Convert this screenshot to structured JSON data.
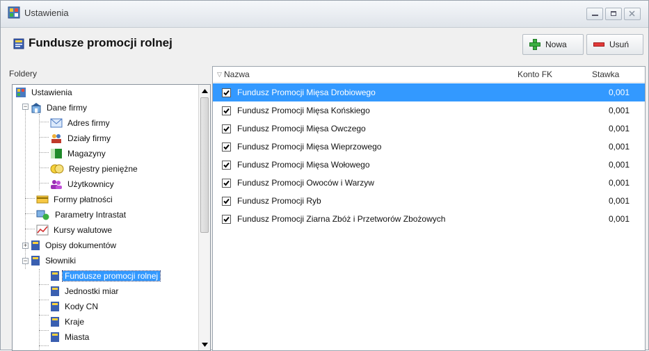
{
  "window": {
    "title": "Ustawienia",
    "header_title": "Fundusze promocji rolnej"
  },
  "toolbar": {
    "new_label": "Nowa",
    "delete_label": "Usuń"
  },
  "left": {
    "header": "Foldery",
    "tree": [
      {
        "label": "Ustawienia"
      },
      {
        "label": "Dane firmy"
      },
      {
        "label": "Adres firmy"
      },
      {
        "label": "Działy firmy"
      },
      {
        "label": "Magazyny"
      },
      {
        "label": "Rejestry pieniężne"
      },
      {
        "label": "Użytkownicy"
      },
      {
        "label": "Formy płatności"
      },
      {
        "label": "Parametry Intrastat"
      },
      {
        "label": "Kursy walutowe"
      },
      {
        "label": "Opisy dokumentów"
      },
      {
        "label": "Słowniki"
      },
      {
        "label": "Fundusze promocji rolnej"
      },
      {
        "label": "Jednostki miar"
      },
      {
        "label": "Kody CN"
      },
      {
        "label": "Kraje"
      },
      {
        "label": "Miasta"
      }
    ]
  },
  "table": {
    "columns": {
      "name": "Nazwa",
      "konto": "Konto FK",
      "stawka": "Stawka"
    },
    "rows": [
      {
        "name": "Fundusz Promocji Mięsa Drobiowego",
        "stawka": "0,001",
        "checked": true
      },
      {
        "name": "Fundusz Promocji Mięsa Końskiego",
        "stawka": "0,001",
        "checked": true
      },
      {
        "name": "Fundusz Promocji Mięsa Owczego",
        "stawka": "0,001",
        "checked": true
      },
      {
        "name": "Fundusz Promocji Mięsa Wieprzowego",
        "stawka": "0,001",
        "checked": true
      },
      {
        "name": "Fundusz Promocji Mięsa Wołowego",
        "stawka": "0,001",
        "checked": true
      },
      {
        "name": "Fundusz Promocji Owoców i Warzyw",
        "stawka": "0,001",
        "checked": true
      },
      {
        "name": "Fundusz Promocji Ryb",
        "stawka": "0,001",
        "checked": true
      },
      {
        "name": "Fundusz Promocji Ziarna Zbóż i Przetworów Zbożowych",
        "stawka": "0,001",
        "checked": true
      }
    ]
  },
  "colors": {
    "selection": "#3399ff",
    "add": "#2e9d2e",
    "remove": "#d32f2f"
  }
}
